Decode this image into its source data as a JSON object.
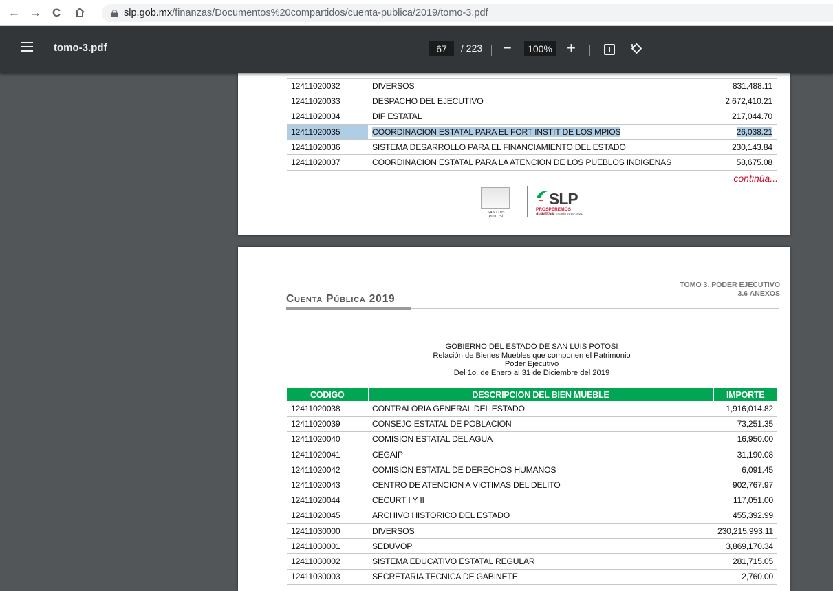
{
  "browser": {
    "url_host": "slp.gob.mx",
    "url_path": "/finanzas/Documentos%20compartidos/cuenta-publica/2019/tomo-3.pdf"
  },
  "viewer": {
    "file_name": "tomo-3.pdf",
    "current_page": "67",
    "total_pages": "/ 223",
    "zoom": "100%"
  },
  "page1": {
    "rows": [
      {
        "code": "12411020032",
        "desc": "DIVERSOS",
        "amount": "831,488.11"
      },
      {
        "code": "12411020033",
        "desc": "DESPACHO DEL EJECUTIVO",
        "amount": "2,672,410.21"
      },
      {
        "code": "12411020034",
        "desc": "DIF ESTATAL",
        "amount": "217,044.70"
      },
      {
        "code": "12411020035",
        "desc": "COORDINACION ESTATAL PARA EL FORT INSTIT DE LOS MPIOS",
        "amount": "26,038.21"
      },
      {
        "code": "12411020036",
        "desc": "SISTEMA DESARROLLO PARA EL FINANCIAMIENTO DEL ESTADO",
        "amount": "230,143.84"
      },
      {
        "code": "12411020037",
        "desc": "COORDINACION ESTATAL PARA LA ATENCION DE LOS PUEBLOS INDIGENAS",
        "amount": "58,675.08"
      }
    ],
    "continua": "continúa...",
    "logo_sanluis": "SAN LUIS POTOSÍ",
    "logo_slp": "SLP",
    "logo_prosperemos": "PROSPEREMOS JUNTOS",
    "logo_gobierno": "Gobierno del Estado 2015-2021"
  },
  "page2": {
    "tomo": "TOMO 3. PODER EJECUTIVO",
    "anexos": "3.6 ANEXOS",
    "cuenta": "Cuenta Pública 2019",
    "title_lines": [
      "GOBIERNO DEL ESTADO DE SAN LUIS POTOSI",
      "Relación de Bienes Muebles que componen el Patrimonio",
      "Poder Ejecutivo",
      "Del 1o. de Enero al 31 de Diciembre del 2019"
    ],
    "headers": {
      "code": "CODIGO",
      "desc": "DESCRIPCION DEL BIEN MUEBLE",
      "amount": "IMPORTE"
    },
    "rows": [
      {
        "code": "12411020038",
        "desc": "CONTRALORIA GENERAL DEL ESTADO",
        "amount": "1,916,014.82"
      },
      {
        "code": "12411020039",
        "desc": "CONSEJO ESTATAL DE POBLACION",
        "amount": "73,251.35"
      },
      {
        "code": "12411020040",
        "desc": "COMISION ESTATAL DEL AGUA",
        "amount": "16,950.00"
      },
      {
        "code": "12411020041",
        "desc": "CEGAIP",
        "amount": "31,190.08"
      },
      {
        "code": "12411020042",
        "desc": "COMISION ESTATAL DE DERECHOS HUMANOS",
        "amount": "6,091.45"
      },
      {
        "code": "12411020043",
        "desc": "CENTRO DE ATENCION A VICTIMAS DEL DELITO",
        "amount": "902,767.97"
      },
      {
        "code": "12411020044",
        "desc": "CECURT I Y II",
        "amount": "117,051.00"
      },
      {
        "code": "12411020045",
        "desc": "ARCHIVO HISTORICO DEL ESTADO",
        "amount": "455,392.99"
      },
      {
        "code": "12411030000",
        "desc": "DIVERSOS",
        "amount": "230,215,993.11"
      },
      {
        "code": "12411030001",
        "desc": "SEDUVOP",
        "amount": "3,869,170.34"
      },
      {
        "code": "12411030002",
        "desc": "SISTEMA EDUCATIVO ESTATAL REGULAR",
        "amount": "281,715.05"
      },
      {
        "code": "12411030003",
        "desc": "SECRETARIA TECNICA DE GABINETE",
        "amount": "2,760.00"
      }
    ]
  }
}
